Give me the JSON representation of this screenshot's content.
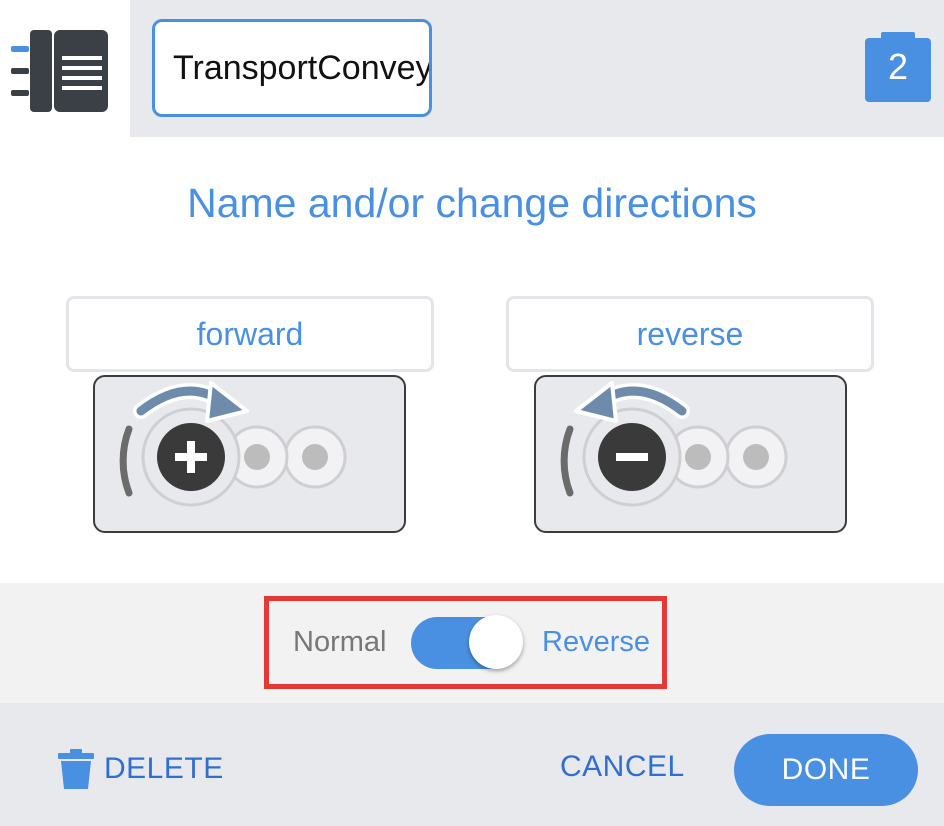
{
  "header": {
    "device_icon": "motor-device-icon",
    "name_value": "TransportConvey",
    "port_number": "2",
    "port_icon": "port-badge-icon"
  },
  "dialog": {
    "title": "Name and/or change directions"
  },
  "directions": {
    "forward": {
      "label": "forward",
      "icon": "forward-rotation-icon"
    },
    "reverse": {
      "label": "reverse",
      "icon": "reverse-rotation-icon"
    }
  },
  "toggle": {
    "label_normal": "Normal",
    "label_reverse": "Reverse",
    "state": "Reverse"
  },
  "footer": {
    "delete_label": "DELETE",
    "delete_icon": "trash-icon",
    "cancel_label": "CANCEL",
    "done_label": "DONE"
  },
  "colors": {
    "accent": "#4a90e2",
    "link": "#2f6fd0",
    "highlight": "#e53935",
    "panel": "#e8e9ed"
  }
}
